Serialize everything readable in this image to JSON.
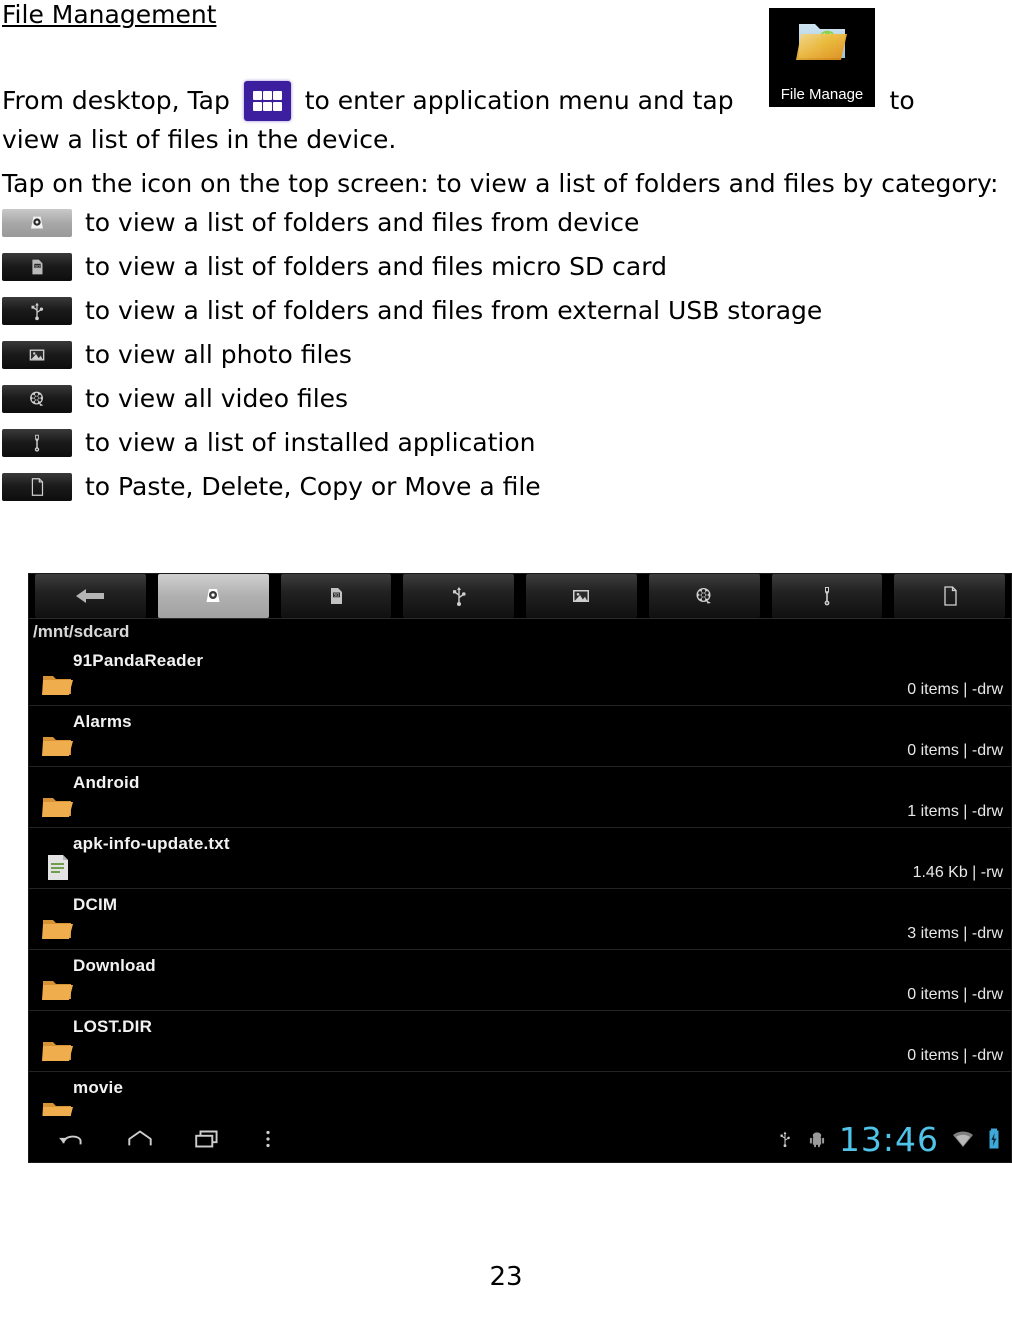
{
  "document": {
    "heading": "File Management",
    "paragraph_lines": [
      {
        "before": "From desktop, Tap",
        "icon": "app-drawer-icon",
        "middle": "to enter application menu and tap",
        "icon2": "file-manager-app-icon",
        "after": "to"
      },
      {
        "text": "view a list of files in the device."
      },
      {
        "text": "Tap on the icon on the top screen: to view a list of folders and files by category:"
      }
    ],
    "line_view_files": "view a list of files in the device.",
    "line_tap_icon": "Tap on the icon on the top screen: to view a list of folders and files by category:",
    "tap_prefix": "From desktop, Tap",
    "tap_middle": "to enter application menu and tap",
    "tap_suffix": "to",
    "page_number": "23"
  },
  "file_manager_tile": {
    "label": "File Manage",
    "icon": "folder-android-icon"
  },
  "legend": [
    {
      "icon": "device-storage-icon",
      "active": true,
      "text": "to view a list of folders and files from device"
    },
    {
      "icon": "sd-card-icon",
      "active": false,
      "text": "to view a list of folders and files micro SD card"
    },
    {
      "icon": "usb-icon",
      "active": false,
      "text": "to view a list of folders and files from external USB storage"
    },
    {
      "icon": "photo-icon",
      "active": false,
      "text": "to view all photo files"
    },
    {
      "icon": "video-reel-icon",
      "active": false,
      "text": "to view all video files"
    },
    {
      "icon": "wrench-icon",
      "active": false,
      "text": "to view a list of installed application"
    },
    {
      "icon": "document-icon",
      "active": false,
      "text": "to Paste, Delete, Copy or Move a file"
    }
  ],
  "screenshot": {
    "toolbar": [
      {
        "icon": "back-arrow-icon",
        "name": "back",
        "active": false
      },
      {
        "icon": "device-storage-icon",
        "name": "device",
        "active": true
      },
      {
        "icon": "sd-card-icon",
        "name": "sdcard",
        "active": false
      },
      {
        "icon": "usb-icon",
        "name": "usb",
        "active": false
      },
      {
        "icon": "photo-icon",
        "name": "photos",
        "active": false
      },
      {
        "icon": "video-reel-icon",
        "name": "videos",
        "active": false
      },
      {
        "icon": "wrench-icon",
        "name": "apps",
        "active": false
      },
      {
        "icon": "document-icon",
        "name": "editor",
        "active": false
      }
    ],
    "path": "/mnt/sdcard",
    "files": [
      {
        "name": "91PandaReader",
        "meta": "0 items | -drw",
        "icon": "folder-icon"
      },
      {
        "name": "Alarms",
        "meta": "0 items | -drw",
        "icon": "folder-icon"
      },
      {
        "name": "Android",
        "meta": "1 items | -drw",
        "icon": "folder-icon"
      },
      {
        "name": "apk-info-update.txt",
        "meta": "1.46 Kb  | -rw",
        "icon": "text-file-icon"
      },
      {
        "name": "DCIM",
        "meta": "3 items | -drw",
        "icon": "folder-icon"
      },
      {
        "name": "Download",
        "meta": "0 items | -drw",
        "icon": "folder-icon"
      },
      {
        "name": "LOST.DIR",
        "meta": "0 items | -drw",
        "icon": "folder-icon"
      },
      {
        "name": "movie",
        "meta": "",
        "icon": "folder-icon"
      }
    ],
    "navbar": {
      "buttons": [
        "back-icon",
        "home-icon",
        "recents-icon",
        "menu-icon"
      ],
      "status_icons": [
        "usb-icon",
        "android-debug-icon"
      ],
      "clock": "13:46",
      "trailing_icons": [
        "wifi-icon",
        "battery-charging-icon"
      ]
    }
  },
  "colors": {
    "app_drawer_purple": "#3b1f9e",
    "clock_cyan": "#4fc3e8",
    "folder_orange": "#e8a33d",
    "screen_black": "#000000"
  }
}
